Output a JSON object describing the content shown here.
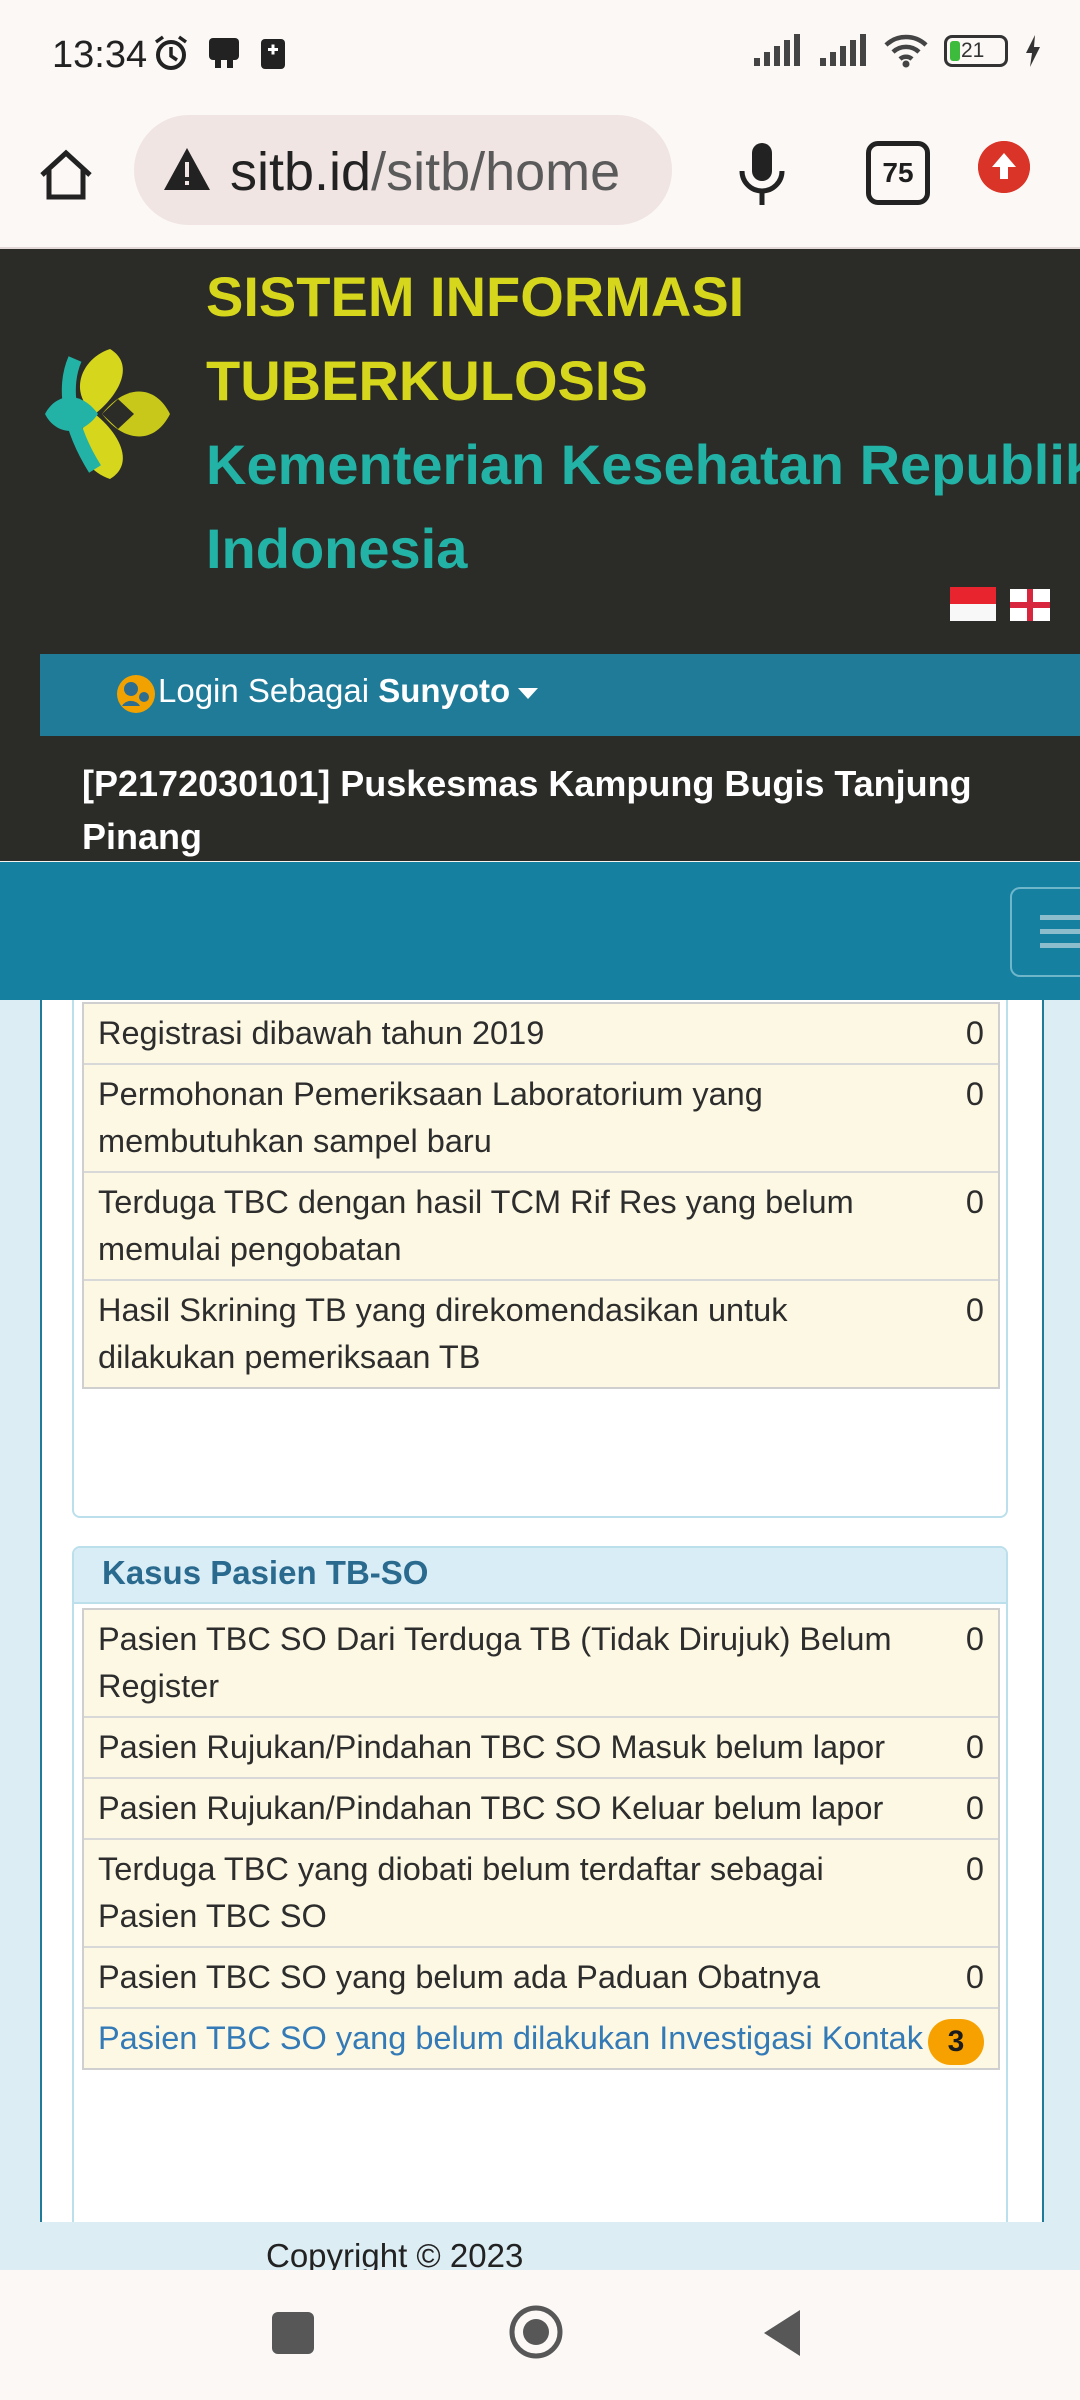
{
  "status_bar": {
    "time": "13:34",
    "battery": "21",
    "icons_left": [
      "alarm-icon",
      "notification-icon",
      "sim-icon"
    ],
    "icons_right": [
      "signal-icon",
      "signal-icon",
      "wifi-icon",
      "battery-icon",
      "charging-icon"
    ]
  },
  "browser": {
    "url_host": "sitb.id",
    "url_path": "/sitb/home",
    "tab_count": "75"
  },
  "header": {
    "title_line1": "SISTEM INFORMASI",
    "title_line2": "TUBERKULOSIS",
    "subtitle_line1": "Kementerian Kesehatan Republik",
    "subtitle_line2": "Indonesia",
    "login_prefix": "Login Sebagai ",
    "login_user": "Sunyoto",
    "facility": "[P2172030101] Puskesmas Kampung Bugis Tanjung Pinang"
  },
  "panel1": {
    "rows": [
      {
        "label": "Registrasi dibawah tahun 2019",
        "count": "0"
      },
      {
        "label": "Permohonan Pemeriksaan Laboratorium yang membutuhkan sampel baru",
        "count": "0"
      },
      {
        "label": "Terduga TBC dengan hasil TCM Rif Res yang belum memulai pengobatan",
        "count": "0"
      },
      {
        "label": "Hasil Skrining TB yang direkomendasikan untuk dilakukan pemeriksaan TB",
        "count": "0"
      }
    ]
  },
  "panel2": {
    "title": "Kasus Pasien TB-SO",
    "rows": [
      {
        "label": "Pasien TBC SO Dari Terduga TB (Tidak Dirujuk) Belum Register",
        "count": "0"
      },
      {
        "label": "Pasien Rujukan/Pindahan TBC SO Masuk belum lapor",
        "count": "0"
      },
      {
        "label": "Pasien Rujukan/Pindahan TBC SO Keluar belum lapor",
        "count": "0"
      },
      {
        "label": "Terduga TBC yang diobati belum terdaftar sebagai Pasien TBC SO",
        "count": "0"
      },
      {
        "label": "Pasien TBC SO yang belum ada Paduan Obatnya",
        "count": "0"
      },
      {
        "label": "Pasien TBC SO yang belum dilakukan Investigasi Kontak",
        "count": "3"
      }
    ]
  },
  "footer": {
    "copyright": "Copyright © 2023"
  },
  "colors": {
    "header_bg": "#2b2b28",
    "title_yellow": "#d6d61c",
    "title_teal": "#22b3a6",
    "nav_blue": "#1580a0",
    "row_bg": "#fcf8e3",
    "badge": "#f7a100",
    "link": "#337ab7"
  }
}
